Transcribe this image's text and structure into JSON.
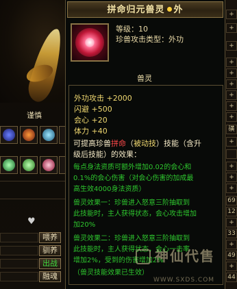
{
  "left": {
    "pet_name": "谨慎",
    "buttons": [
      {
        "label": "喂养",
        "green": false
      },
      {
        "label": "驯养",
        "green": false
      },
      {
        "label": "出战",
        "green": true
      },
      {
        "label": "融魂",
        "green": false
      }
    ]
  },
  "right": {
    "cells": [
      "+",
      "+",
      "+",
      "+",
      "+",
      "+",
      "+",
      "+",
      "+",
      "磺",
      "+",
      "",
      "+",
      "+",
      "+",
      "69",
      "12",
      "+",
      "33",
      "+",
      "49",
      "+",
      "44",
      "+"
    ]
  },
  "tooltip": {
    "title_left": "拼命归元兽灵",
    "title_right": "外",
    "level_line": "等级：10",
    "type_line": "珍兽攻击类型：外功",
    "section_title": "兽灵",
    "stats": [
      "外功攻击 +2000",
      "闪避 +500",
      "会心 +20",
      "体力 +40"
    ],
    "desc_line1_prefix": "可提高珍兽",
    "desc_line1_hl": "拼命",
    "desc_line1_mid": "（",
    "desc_line1_skill": "被动技",
    "desc_line1_suffix": "）技能（含升",
    "desc_line2": "级后技能）的效果：",
    "green_lines": [
      "每点身法资质可额外增加0.02的会心和",
      "0.1%的会心伤害（对会心伤害的加成最",
      "高生效4000身法资质）",
      "兽灵效果一：珍兽进入怒意三阶抽取到",
      "此技能时，主人获得状态，会心攻击增加",
      "加20%",
      "兽灵效果二：珍兽进入怒意三阶抽取到",
      "此技能时，主人获得状态，会心一击率",
      "增加2%，受到的伤害增加2%",
      "（兽灵技能效果已生效）"
    ]
  },
  "watermark": {
    "big": "神仙代售",
    "small": "WWW.SXDS.COM"
  },
  "colors": {
    "title_gold": "#f2e2a6",
    "stat_gold": "#f0d870",
    "green": "#2ec62e",
    "red": "#ff4a4a",
    "frame": "#8a7446"
  }
}
